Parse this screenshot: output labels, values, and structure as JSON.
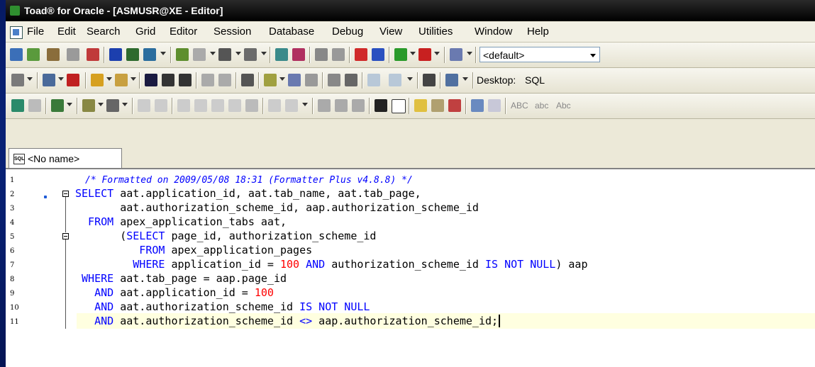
{
  "window": {
    "title": "Toad® for Oracle - [ASMUSR@XE - Editor]"
  },
  "menu": {
    "items": [
      "File",
      "Edit",
      "Search",
      "Grid",
      "Editor",
      "Session",
      "Database",
      "Debug",
      "View",
      "Utilities",
      "Window",
      "Help"
    ]
  },
  "toolbar": {
    "schema_combo": "<default>",
    "desktop_label": "Desktop:",
    "desktop_value": "SQL",
    "case_labels": [
      "ABC",
      "abc",
      "Abc"
    ]
  },
  "editor": {
    "tab_label": "<No name>",
    "tab_icon": "sql-file-icon",
    "line_numbers": [
      "1",
      "2",
      "3",
      "4",
      "5",
      "6",
      "7",
      "8",
      "9",
      "10",
      "11"
    ],
    "comment": "/* Formatted on 2009/05/08 18:31 (Formatter Plus v4.8.8) */",
    "lines": [
      [
        {
          "t": "SELECT",
          "c": "kw"
        },
        {
          "t": " aat.application_id, aat.tab_name, aat.tab_page,",
          "c": ""
        }
      ],
      [
        {
          "t": "       aat.authorization_scheme_id, aap.authorization_scheme_id",
          "c": ""
        }
      ],
      [
        {
          "t": "  FROM",
          "c": "kw"
        },
        {
          "t": " apex_application_tabs aat,",
          "c": ""
        }
      ],
      [
        {
          "t": "       (",
          "c": ""
        },
        {
          "t": "SELECT",
          "c": "kw"
        },
        {
          "t": " page_id, authorization_scheme_id",
          "c": ""
        }
      ],
      [
        {
          "t": "          FROM",
          "c": "kw"
        },
        {
          "t": " apex_application_pages",
          "c": ""
        }
      ],
      [
        {
          "t": "         WHERE",
          "c": "kw"
        },
        {
          "t": " application_id = ",
          "c": ""
        },
        {
          "t": "100",
          "c": "num"
        },
        {
          "t": " ",
          "c": ""
        },
        {
          "t": "AND",
          "c": "kw"
        },
        {
          "t": " authorization_scheme_id ",
          "c": ""
        },
        {
          "t": "IS NOT NULL",
          "c": "kw"
        },
        {
          "t": ") aap",
          "c": ""
        }
      ],
      [
        {
          "t": " WHERE",
          "c": "kw"
        },
        {
          "t": " aat.tab_page = aap.page_id",
          "c": ""
        }
      ],
      [
        {
          "t": "   AND",
          "c": "kw"
        },
        {
          "t": " aat.application_id = ",
          "c": ""
        },
        {
          "t": "100",
          "c": "num"
        }
      ],
      [
        {
          "t": "   AND",
          "c": "kw"
        },
        {
          "t": " aat.authorization_scheme_id ",
          "c": ""
        },
        {
          "t": "IS NOT NULL",
          "c": "kw"
        }
      ],
      [
        {
          "t": "   AND",
          "c": "kw"
        },
        {
          "t": " aat.authorization_scheme_id ",
          "c": ""
        },
        {
          "t": "<>",
          "c": "kw"
        },
        {
          "t": " aap.authorization_scheme_id;",
          "c": ""
        }
      ]
    ]
  },
  "colors": {
    "keyword": "#0000ff",
    "number": "#ff0000",
    "current_line": "#ffffe0",
    "titlebar": "#000000"
  }
}
